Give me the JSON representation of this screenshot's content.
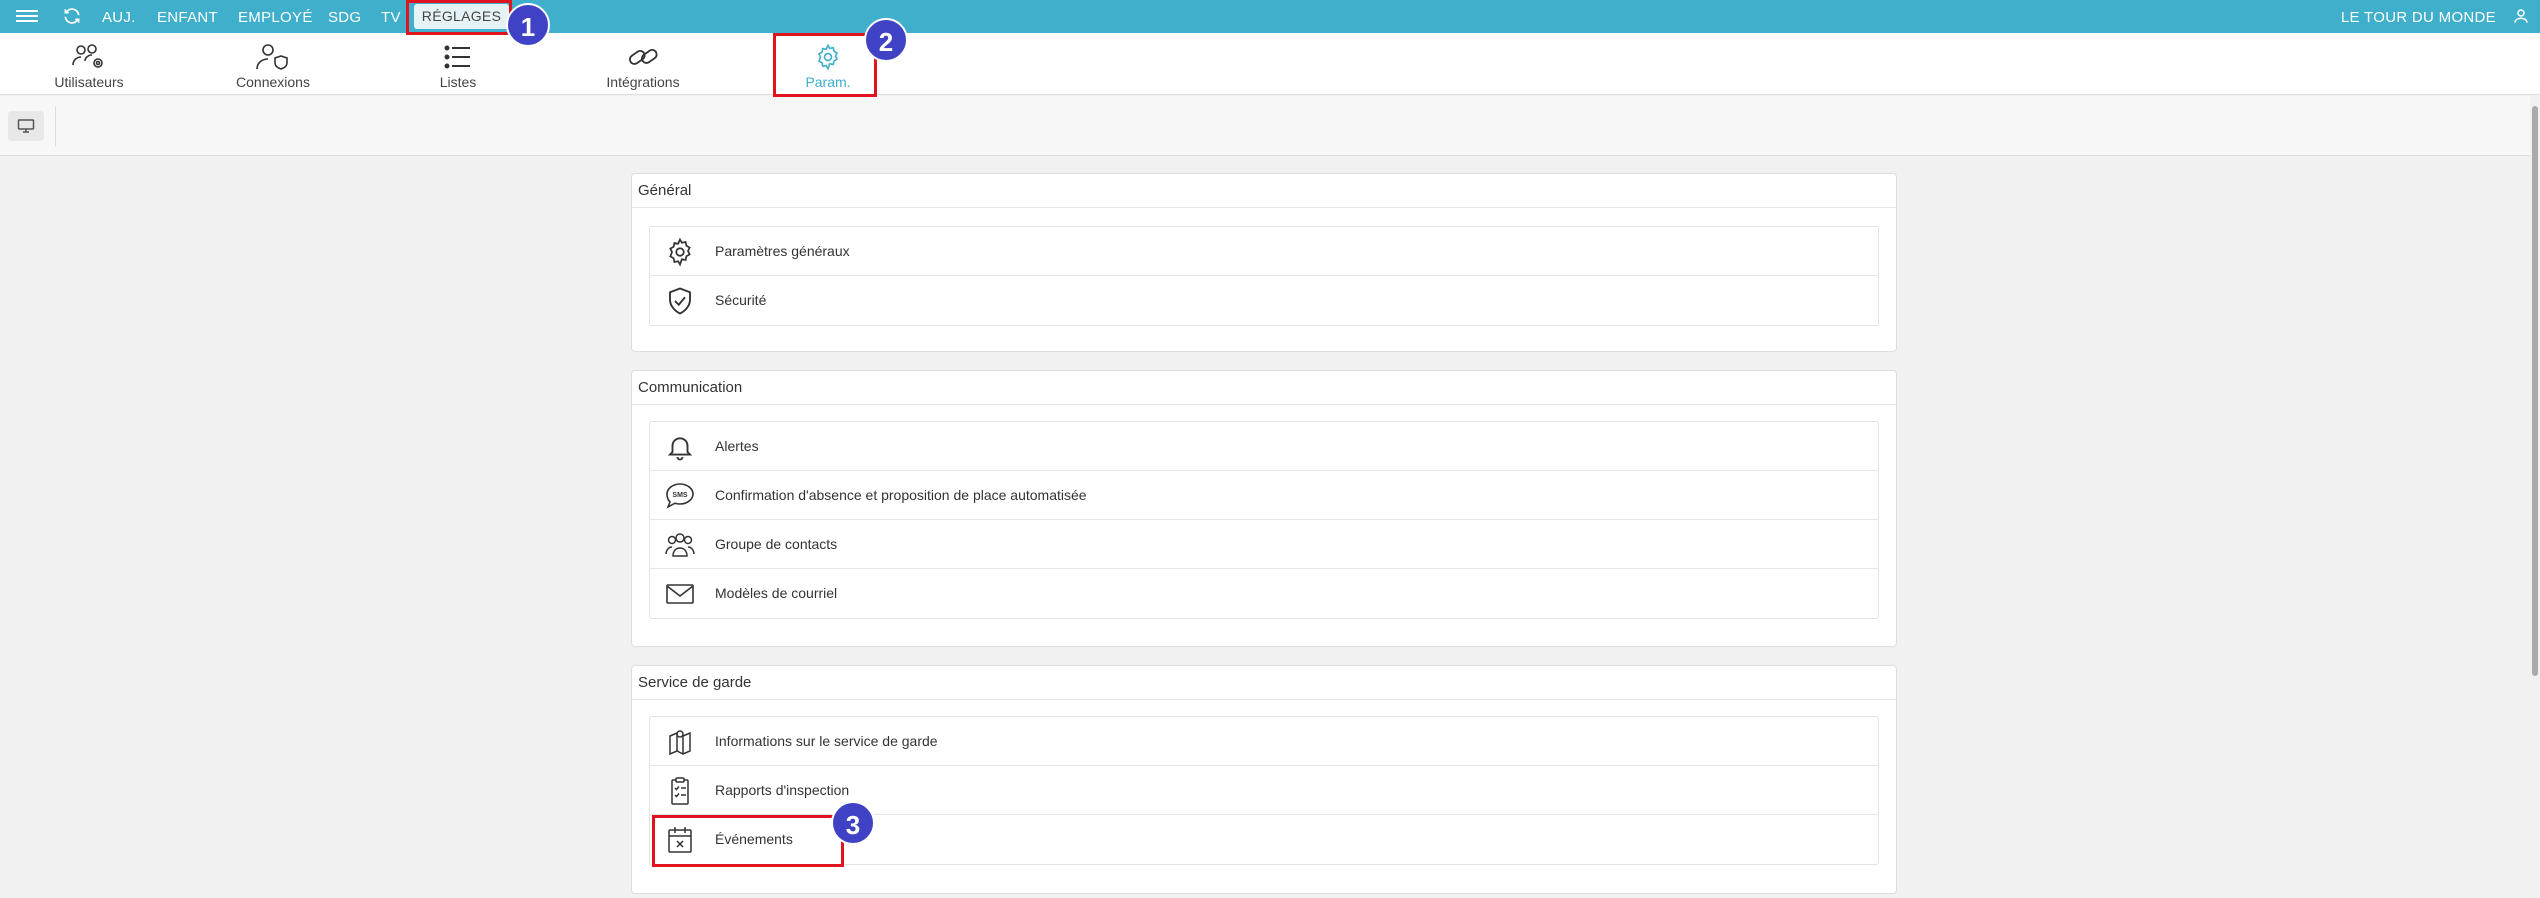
{
  "topnav": {
    "items": [
      "AUJ.",
      "ENFANT",
      "EMPLOYÉ",
      "SDG",
      "TV"
    ],
    "active": "RÉGLAGES",
    "organization": "LE TOUR DU MONDE"
  },
  "subnav": {
    "items": [
      {
        "label": "Utilisateurs",
        "icon": "users-gear-icon"
      },
      {
        "label": "Connexions",
        "icon": "user-shield-icon"
      },
      {
        "label": "Listes",
        "icon": "list-icon"
      },
      {
        "label": "Intégrations",
        "icon": "link-icon"
      },
      {
        "label": "Param.",
        "icon": "gear-icon"
      }
    ],
    "active_index": 4
  },
  "sections": [
    {
      "title": "Général",
      "items": [
        {
          "label": "Paramètres généraux",
          "icon": "gear-icon"
        },
        {
          "label": "Sécurité",
          "icon": "shield-check-icon"
        }
      ]
    },
    {
      "title": "Communication",
      "items": [
        {
          "label": "Alertes",
          "icon": "bell-icon"
        },
        {
          "label": "Confirmation d'absence et proposition de place automatisée",
          "icon": "sms-bubble-icon"
        },
        {
          "label": "Groupe de contacts",
          "icon": "group-icon"
        },
        {
          "label": "Modèles de courriel",
          "icon": "envelope-icon"
        }
      ]
    },
    {
      "title": "Service de garde",
      "items": [
        {
          "label": "Informations sur le service de garde",
          "icon": "map-pin-icon"
        },
        {
          "label": "Rapports d'inspection",
          "icon": "clipboard-check-icon"
        },
        {
          "label": "Événements",
          "icon": "calendar-x-icon"
        }
      ]
    }
  ],
  "callouts": [
    "1",
    "2",
    "3"
  ],
  "colors": {
    "primary": "#3fafcb",
    "highlight": "#e0141e",
    "badge": "#3f42c4"
  }
}
